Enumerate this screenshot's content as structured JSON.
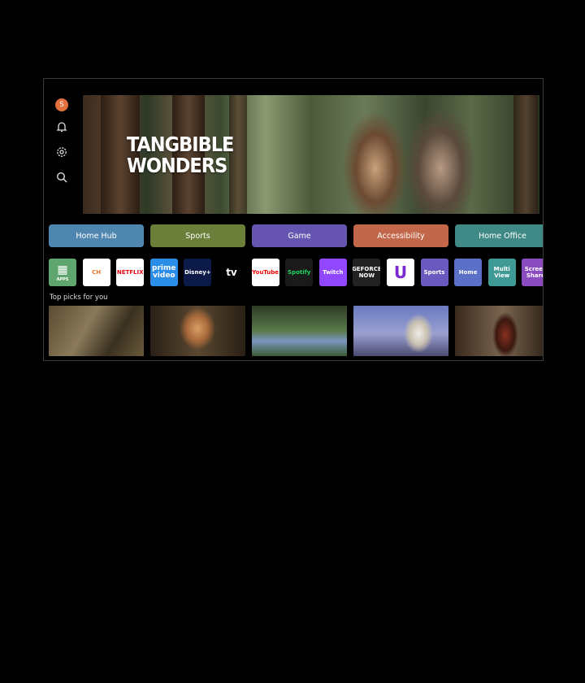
{
  "sidebar": {
    "avatar_initial": "S",
    "icons": [
      "bell-icon",
      "gear-icon",
      "search-icon"
    ]
  },
  "banner": {
    "title_line1": "TANGBIBLE",
    "title_line2": "WONDERS"
  },
  "categories": [
    {
      "label": "Home Hub",
      "color": "#4f86b0"
    },
    {
      "label": "Sports",
      "color": "#6c7f3a"
    },
    {
      "label": "Game",
      "color": "#6555b0"
    },
    {
      "label": "Accessibility",
      "color": "#c2674a"
    },
    {
      "label": "Home Office",
      "color": "#3f8a86"
    }
  ],
  "apps": [
    {
      "name": "APPS"
    },
    {
      "name": "CH"
    },
    {
      "name": "NETFLIX"
    },
    {
      "name": "prime video"
    },
    {
      "name": "Disney+"
    },
    {
      "name": "tv"
    },
    {
      "name": "YouTube"
    },
    {
      "name": "Spotify"
    },
    {
      "name": "Twitch"
    },
    {
      "name": "GEFORCE NOW"
    },
    {
      "name": "U"
    },
    {
      "name": "Sports"
    },
    {
      "name": "Home"
    },
    {
      "name": "Multi View"
    },
    {
      "name": "Screen Share"
    }
  ],
  "picks": {
    "label": "Top picks for you"
  }
}
